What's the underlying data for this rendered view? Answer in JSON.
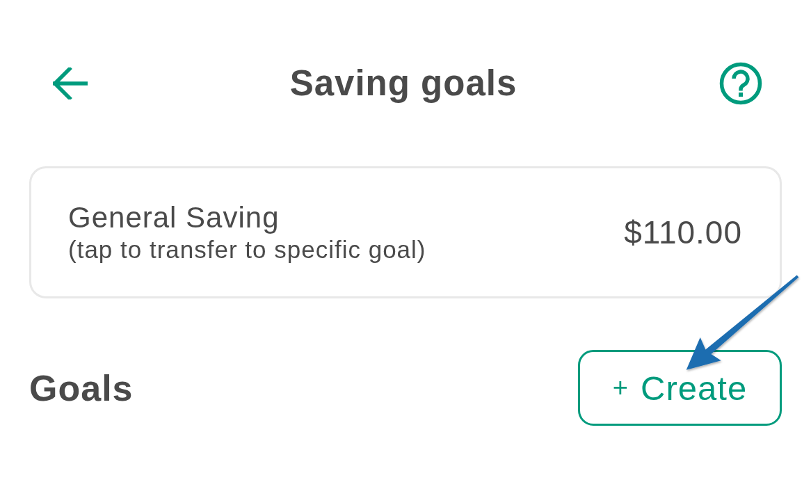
{
  "header": {
    "title": "Saving goals"
  },
  "general_saving": {
    "name": "General Saving",
    "hint": "(tap to transfer to specific goal)",
    "amount": "$110.00"
  },
  "goals_section": {
    "title": "Goals",
    "create_button": {
      "icon": "+",
      "label": "Create"
    }
  }
}
